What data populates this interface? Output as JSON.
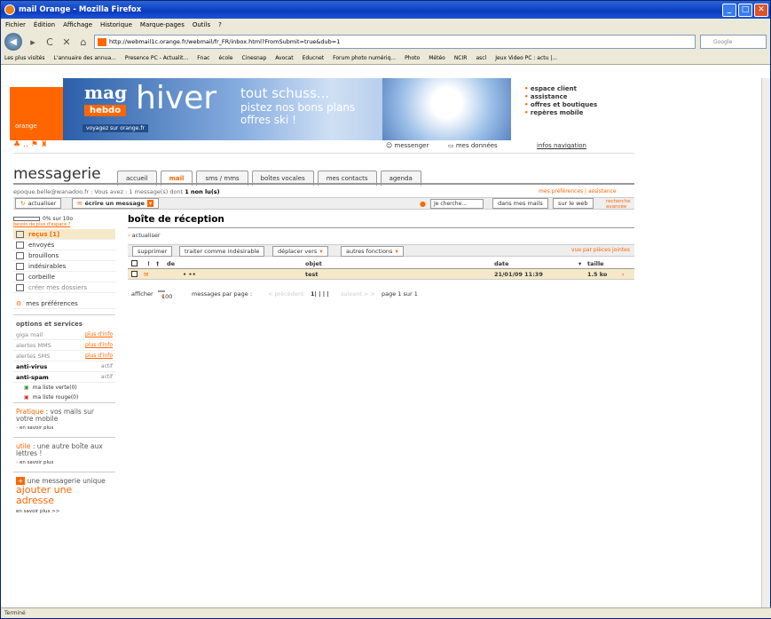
{
  "browser": {
    "title": "mail Orange - Mozilla Firefox",
    "menu": [
      "Fichier",
      "Édition",
      "Affichage",
      "Historique",
      "Marque-pages",
      "Outils",
      "?"
    ],
    "url": "http://webmail1c.orange.fr/webmail/fr_FR/inbox.html?FromSubmit=true&dub=1",
    "search_engine": "Google",
    "bookmarks": [
      "Les plus visités",
      "L'annuaire des annua...",
      "Presence PC - Actualit...",
      "Fnac",
      "école",
      "Cinesnap",
      "Avocat",
      "Educnet",
      "Forum photo numériq...",
      "Photo",
      "Météo",
      "NCIR",
      "ascl",
      "Jeux Video PC : actu |..."
    ],
    "status": "Terminé"
  },
  "header": {
    "logo": "orange",
    "banner_mag": "mag",
    "banner_hebdo": "hebdo",
    "banner_hiver": "hiver",
    "banner_line1": "tout schuss...",
    "banner_line2": "pistez nos bons plans",
    "banner_line3": "offres ski !",
    "banner_voyages": "voyagez sur orange.fr",
    "right_links": [
      "espace client",
      "assistance",
      "offres et boutiques",
      "repères mobile"
    ],
    "messenger": "messenger",
    "mes_donnees": "mes données",
    "infos_navigation": "infos navigation"
  },
  "app": {
    "title": "messagerie",
    "tabs": [
      "accueil",
      "mail",
      "sms / mms",
      "boîtes vocales",
      "mes contacts",
      "agenda"
    ],
    "account_line_prefix": "epoque.belle@wanadoo.fr : Vous avez : 1 message(s) dont ",
    "account_line_bold": "1 non lu(s)",
    "prefs_link": "mes préférences | assistance",
    "actualiser": "actualiser",
    "ecrire": "écrire un message",
    "search_placeholder": "Je cherche...",
    "dans_mails": "dans mes mails",
    "sur_web": "sur le web",
    "recherche_avancee": "recherche avancée"
  },
  "sidebar": {
    "quota_text": "0% sur 10o",
    "quota_sub": "besoin de plus d'espace ?",
    "folders": [
      {
        "label": "reçus [1]",
        "active": true
      },
      {
        "label": "envoyés",
        "active": false
      },
      {
        "label": "brouillons",
        "active": false
      },
      {
        "label": "indésirables",
        "active": false
      },
      {
        "label": "corbeille",
        "active": false
      },
      {
        "label": "créer mes dossiers",
        "active": false
      }
    ],
    "mes_preferences": "mes préférences",
    "options_title": "options et services",
    "options": [
      {
        "label": "giga mail",
        "right": "plus d'info",
        "bold": false
      },
      {
        "label": "alertes MMS",
        "right": "plus d'info",
        "bold": false
      },
      {
        "label": "alertes SMS",
        "right": "plus d'info",
        "bold": false
      },
      {
        "label": "anti-virus",
        "right": "actif",
        "bold": true
      },
      {
        "label": "anti-spam",
        "right": "actif",
        "bold": true
      }
    ],
    "liste_verte": "ma liste verte(0)",
    "liste_rouge": "ma liste rouge(0)",
    "promo1_a": "Pratique",
    "promo1_b": " : vos mails sur votre mobile",
    "promo1_more": "en savoir plus",
    "promo2_a": "utile",
    "promo2_b": " : une autre boîte aux lettres !",
    "promo2_more": "en savoir plus",
    "promo3_a": "une messagerie unique",
    "promo3_b": "ajouter une adresse",
    "promo3_more": "en savoir plus >>"
  },
  "main": {
    "title": "boîte de réception",
    "actualiser": "actualiser",
    "buttons": [
      "supprimer",
      "traiter comme indésirable",
      "déplacer vers",
      "autres fonctions"
    ],
    "vue_pj": "vue par pièces jointes",
    "columns": {
      "de": "de",
      "objet": "objet",
      "date": "date",
      "taille": "taille"
    },
    "rows": [
      {
        "de": "• ••",
        "objet": "test",
        "date": "21/01/09 11:39",
        "taille": "1.5 ko"
      }
    ],
    "afficher": "afficher",
    "per_page": "100",
    "per_page_label": "messages par page :",
    "precedent": "< précédent",
    "pages": "1| | | |",
    "suivant": "suivant > >",
    "page_info": "page 1 sur 1"
  }
}
